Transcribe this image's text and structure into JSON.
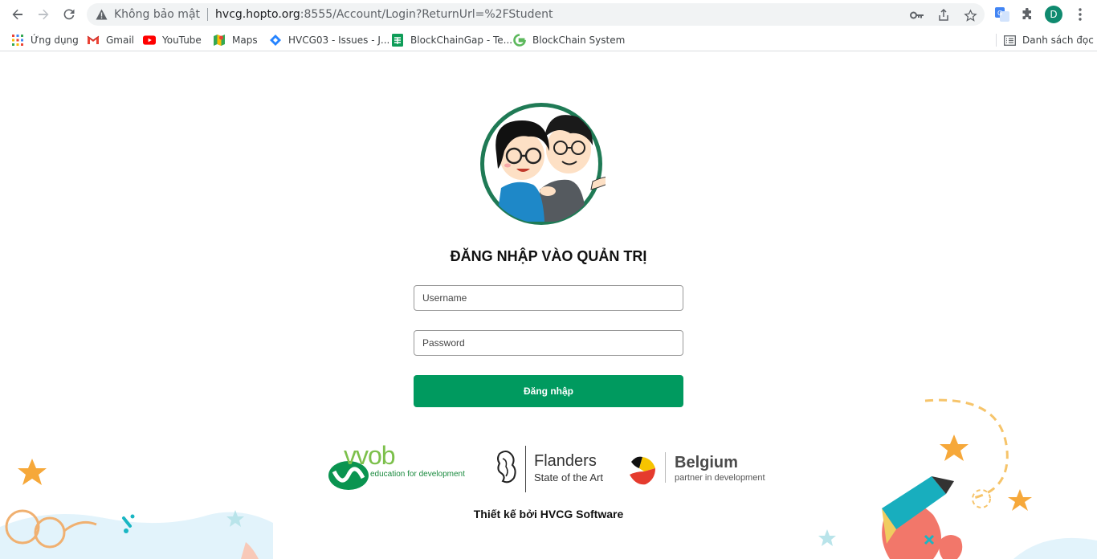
{
  "browser": {
    "security_label": "Không bảo mật",
    "url_host": "hvcg.hopto.org",
    "url_rest": ":8555/Account/Login?ReturnUrl=%2FStudent",
    "profile_initial": "D",
    "accent_color": "#0f8a6f"
  },
  "bookmarks": {
    "items": [
      {
        "label": "Ứng dụng",
        "icon": "apps-grid-icon"
      },
      {
        "label": "Gmail",
        "icon": "gmail-icon"
      },
      {
        "label": "YouTube",
        "icon": "youtube-icon"
      },
      {
        "label": "Maps",
        "icon": "maps-icon"
      },
      {
        "label": "HVCG03 - Issues - J...",
        "icon": "jira-icon"
      },
      {
        "label": "BlockChainGap - Te...",
        "icon": "sheet-icon"
      },
      {
        "label": "BlockChain System",
        "icon": "g-logo-icon"
      }
    ],
    "reading_list": "Danh sách đọc"
  },
  "login": {
    "title": "ĐĂNG NHẬP VÀO QUẢN TRỊ",
    "username_placeholder": "Username",
    "password_placeholder": "Password",
    "submit_label": "Đăng nhập",
    "button_color": "#009a5f"
  },
  "partners": {
    "vvob_name": "vvob",
    "vvob_tagline": "education for development",
    "flanders_name": "Flanders",
    "flanders_tagline": "State of the Art",
    "belgium_name": "Belgium",
    "belgium_tagline": "partner in development"
  },
  "footer": {
    "credit": "Thiết kế bởi HVCG Software"
  }
}
